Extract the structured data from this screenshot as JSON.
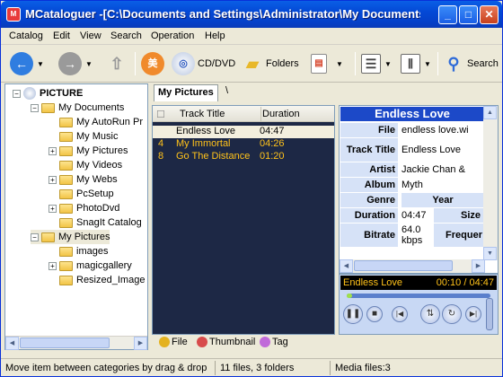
{
  "window": {
    "title": "MCataloguer -[C:\\Documents and Settings\\Administrator\\My Documents\\..."
  },
  "menu": [
    "Catalog",
    "Edit",
    "View",
    "Search",
    "Operation",
    "Help"
  ],
  "toolbar": {
    "cddvd": "CD/DVD",
    "folders": "Folders",
    "search": "Search"
  },
  "tree": {
    "root": "PICTURE",
    "items": [
      "My Documents",
      "My AutoRun Pr",
      "My Music",
      "My Pictures",
      "My Videos",
      "My Webs",
      "PcSetup",
      "PhotoDvd",
      "SnagIt Catalog",
      "My Pictures",
      "images",
      "magicgallery",
      "Resized_Image"
    ]
  },
  "tabs": {
    "active": "My Pictures",
    "other": "\\"
  },
  "list": {
    "headers": [
      "Track Title",
      "Duration"
    ],
    "rows": [
      {
        "num": "",
        "title": "Endless Love",
        "duration": "04:47"
      },
      {
        "num": "4",
        "title": "My Immortal",
        "duration": "04:26"
      },
      {
        "num": "8",
        "title": "Go The Distance",
        "duration": "01:20"
      }
    ]
  },
  "info": {
    "title": "Endless Love",
    "rows": [
      {
        "k": "File",
        "v": "endless love.wi"
      },
      {
        "k": "Track Title",
        "v": "Endless Love"
      },
      {
        "k": "Artist",
        "v": "Jackie Chan &"
      },
      {
        "k": "Album",
        "v": "Myth"
      },
      {
        "k": "Genre",
        "v": "Year"
      },
      {
        "k": "Duration",
        "v": "04:47",
        "extra": "Size"
      },
      {
        "k": "Bitrate",
        "v": "64.0 kbps",
        "extra": "Frequer"
      }
    ]
  },
  "player": {
    "track": "Endless Love",
    "time": "00:10 / 04:47",
    "progress": 0.04
  },
  "bottom_tabs": [
    "File",
    "Thumbnail",
    "Tag"
  ],
  "status": {
    "hint": "Move item between categories by drag & drop",
    "count": "11 files, 3 folders",
    "media": "Media files:3"
  }
}
